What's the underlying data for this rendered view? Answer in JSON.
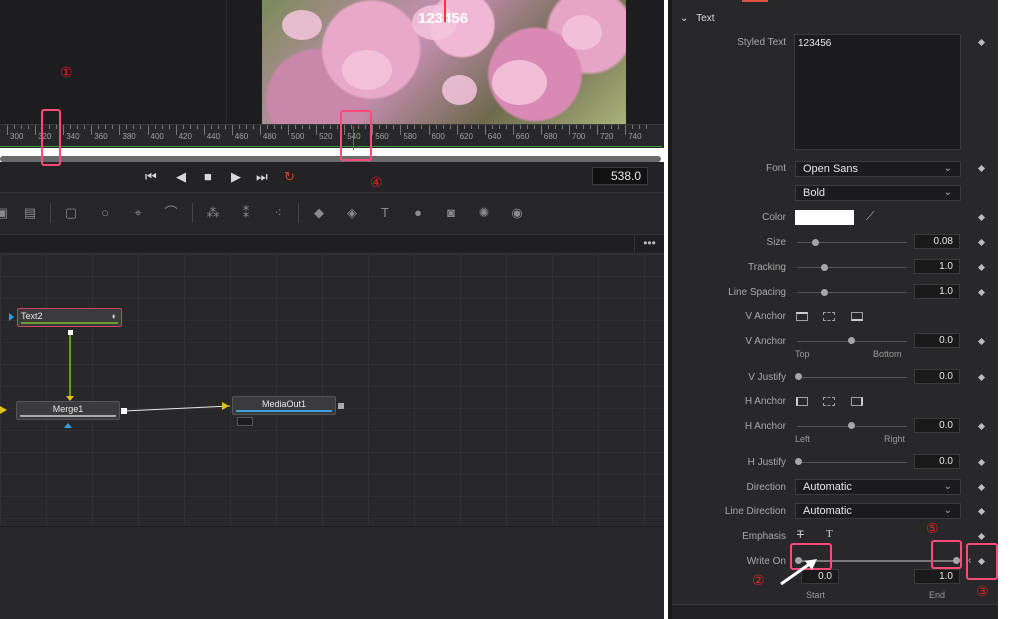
{
  "viewer": {
    "overlay_text": "123456"
  },
  "timeline": {
    "ruler_labels": [
      "300",
      "320",
      "340",
      "360",
      "380",
      "400",
      "420",
      "440",
      "460",
      "480",
      "500",
      "520",
      "540",
      "560",
      "580",
      "600",
      "620",
      "640",
      "660",
      "680",
      "700",
      "720",
      "740"
    ],
    "current_frame": "538.0"
  },
  "transport": {
    "prev_icon": "skip-back-icon",
    "back_icon": "play-reverse-icon",
    "stop_icon": "stop-icon",
    "play_icon": "play-icon",
    "next_icon": "skip-forward-icon",
    "loop_icon": "loop-icon"
  },
  "nodes": {
    "text2": "Text2",
    "merge1": "Merge1",
    "mediaout1": "MediaOut1",
    "menu": "•••"
  },
  "inspector": {
    "section_title": "Text",
    "styled_text_label": "Styled Text",
    "styled_text_value": "123456",
    "font_label": "Font",
    "font_value": "Open Sans",
    "style_value": "Bold",
    "color_label": "Color",
    "color_value": "#ffffff",
    "size_label": "Size",
    "size_value": "0.08",
    "tracking_label": "Tracking",
    "tracking_value": "1.0",
    "line_spacing_label": "Line Spacing",
    "line_spacing_value": "1.0",
    "v_anchor_label": "V Anchor",
    "v_anchor2_label": "V Anchor",
    "v_anchor_value": "0.0",
    "v_anchor_left": "Top",
    "v_anchor_right": "Bottom",
    "v_justify_label": "V Justify",
    "v_justify_value": "0.0",
    "h_anchor_label": "H Anchor",
    "h_anchor2_label": "H Anchor",
    "h_anchor_value": "0.0",
    "h_anchor_left": "Left",
    "h_anchor_right": "Right",
    "h_justify_label": "H Justify",
    "h_justify_value": "0.0",
    "direction_label": "Direction",
    "direction_value": "Automatic",
    "line_direction_label": "Line Direction",
    "line_direction_value": "Automatic",
    "emphasis_label": "Emphasis",
    "write_on_label": "Write On",
    "write_on_start": "0.0",
    "write_on_end": "1.0",
    "start_label": "Start",
    "end_label": "End"
  },
  "annotations": {
    "n1": "①",
    "n2": "②",
    "n3": "③",
    "n4": "④",
    "n5": "⑤"
  },
  "colors": {
    "accent_red": "#ff4a78",
    "annotation_red": "#e02020",
    "node_selected": "#d04060"
  }
}
